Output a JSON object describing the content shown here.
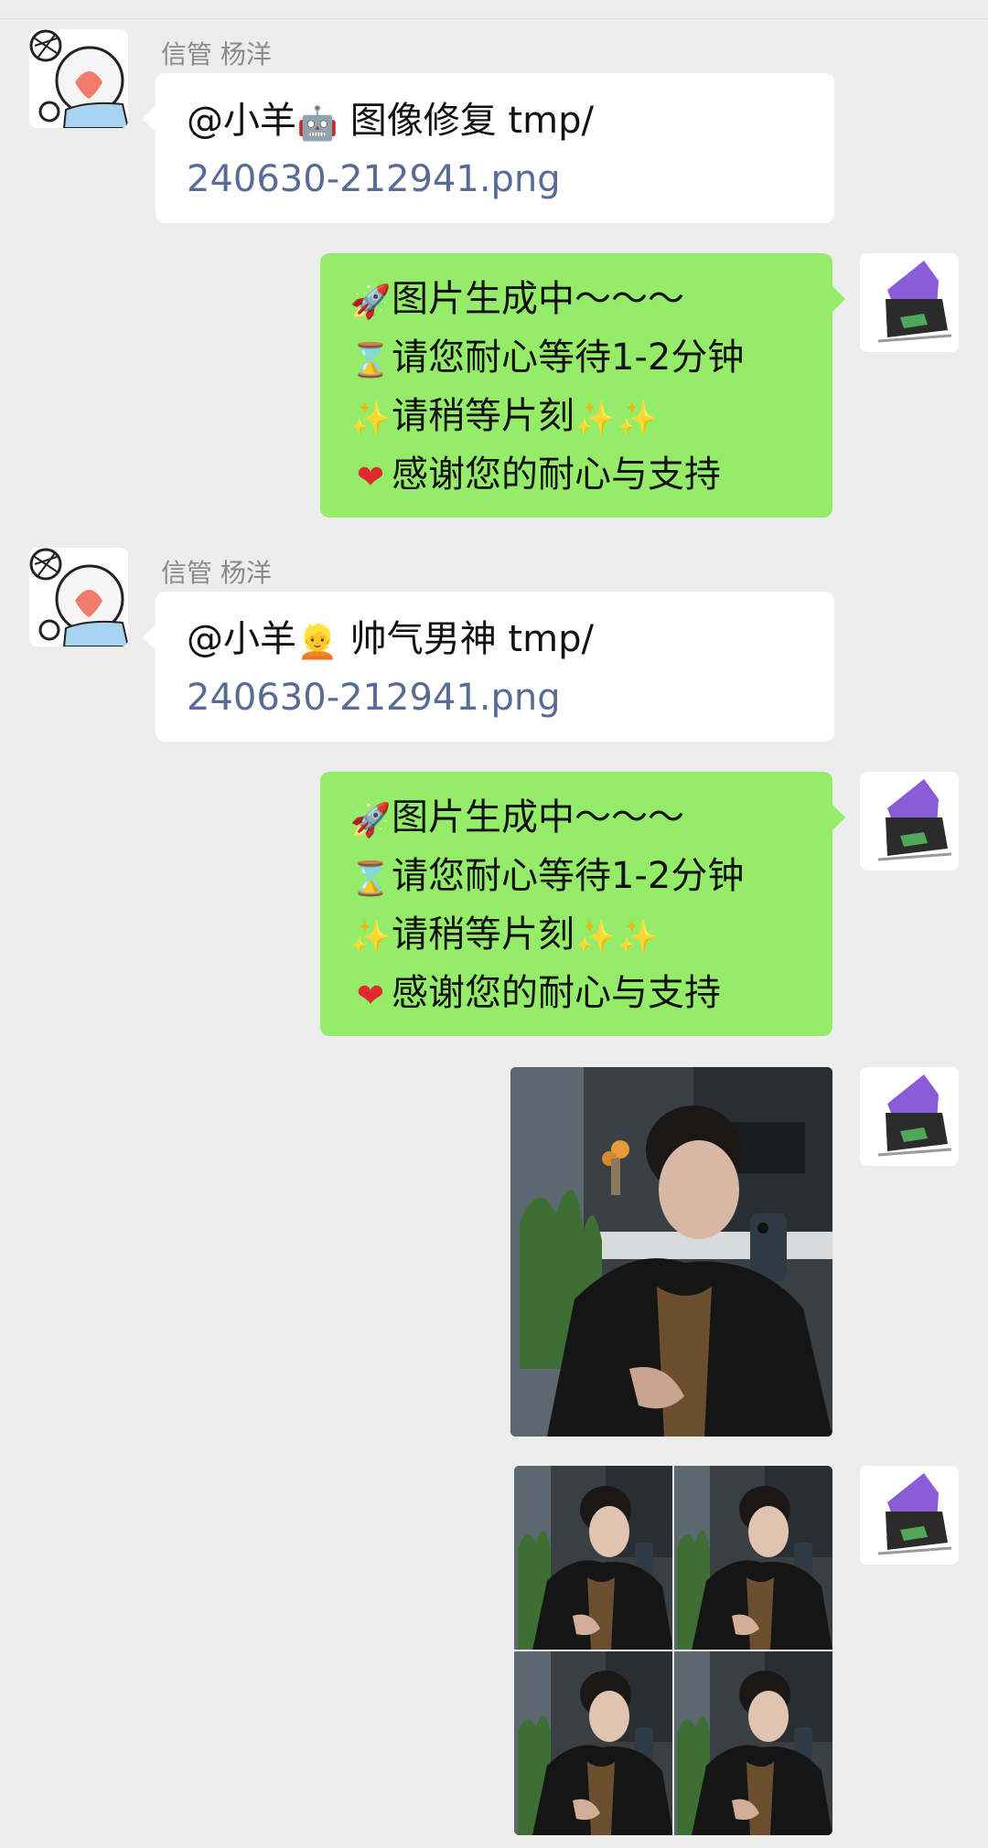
{
  "messages": [
    {
      "sender": "信管 杨洋",
      "mention": "@小羊",
      "icon": "robot",
      "text": " 图像修复 tmp/",
      "link": "240630-212941.png"
    },
    {
      "lines": [
        {
          "icon": "rocket",
          "text": "图片生成中～～～"
        },
        {
          "icon": "hourglass",
          "text": "请您耐心等待1-2分钟"
        },
        {
          "icon": "sparkles",
          "text": "请稍等片刻",
          "trail": "sparkles-pair"
        },
        {
          "icon": "heart",
          "text": "感谢您的耐心与支持"
        }
      ]
    },
    {
      "sender": "信管 杨洋",
      "mention": "@小羊",
      "icon": "person",
      "text": " 帅气男神 tmp/",
      "link": "240630-212941.png"
    },
    {
      "lines": [
        {
          "icon": "rocket",
          "text": "图片生成中～～～"
        },
        {
          "icon": "hourglass",
          "text": "请您耐心等待1-2分钟"
        },
        {
          "icon": "sparkles",
          "text": "请稍等片刻",
          "trail": "sparkles-pair"
        },
        {
          "icon": "heart",
          "text": "感谢您的耐心与支持"
        }
      ]
    },
    {
      "image": "portrait-photo"
    },
    {
      "image": "portrait-grid-2x2"
    }
  ],
  "emoji": {
    "robot": "🤖",
    "person": "👱",
    "rocket": "🚀",
    "hourglass": "⌛",
    "sparkles": "✨",
    "heart": "❤"
  },
  "colors": {
    "background": "#ededed",
    "incoming_bubble": "#ffffff",
    "outgoing_bubble": "#95ec69",
    "link": "#576b95",
    "name": "#8a8a8a"
  }
}
